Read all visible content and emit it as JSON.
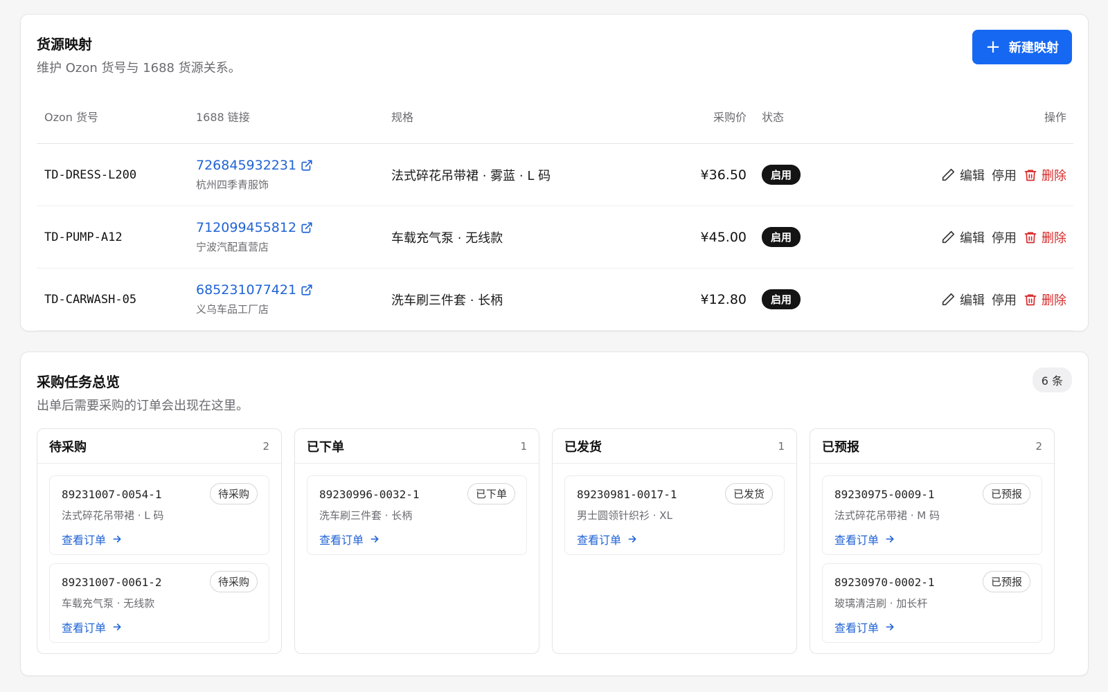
{
  "mapping": {
    "title": "货源映射",
    "subtitle": "维护 Ozon 货号与 1688 货源关系。",
    "new_button_label": "新建映射",
    "columns": {
      "ozon_sku": "Ozon 货号",
      "link": "1688 链接",
      "spec": "规格",
      "price": "采购价",
      "status": "状态",
      "actions": "操作"
    },
    "rows": [
      {
        "sku": "TD-DRESS-L200",
        "offer_id": "726845932231",
        "shop": "杭州四季青服饰",
        "spec": "法式碎花吊带裙 · 雾蓝 · L 码",
        "price": "¥36.50",
        "status": "启用"
      },
      {
        "sku": "TD-PUMP-A12",
        "offer_id": "712099455812",
        "shop": "宁波汽配直营店",
        "spec": "车载充气泵 · 无线款",
        "price": "¥45.00",
        "status": "启用"
      },
      {
        "sku": "TD-CARWASH-05",
        "offer_id": "685231077421",
        "shop": "义乌车品工厂店",
        "spec": "洗车刷三件套 · 长柄",
        "price": "¥12.80",
        "status": "启用"
      }
    ],
    "actions": {
      "edit": "编辑",
      "disable": "停用",
      "delete": "删除"
    }
  },
  "tasks": {
    "title": "采购任务总览",
    "subtitle": "出单后需要采购的订单会出现在这里。",
    "total": "6 条",
    "view_order_label": "查看订单",
    "columns": [
      {
        "title": "待采购",
        "count": "2",
        "items": [
          {
            "id": "89231007-0054-1",
            "status": "待采购",
            "desc": "法式碎花吊带裙 · L 码"
          },
          {
            "id": "89231007-0061-2",
            "status": "待采购",
            "desc": "车载充气泵 · 无线款"
          }
        ]
      },
      {
        "title": "已下单",
        "count": "1",
        "items": [
          {
            "id": "89230996-0032-1",
            "status": "已下单",
            "desc": "洗车刷三件套 · 长柄"
          }
        ]
      },
      {
        "title": "已发货",
        "count": "1",
        "items": [
          {
            "id": "89230981-0017-1",
            "status": "已发货",
            "desc": "男士圆领针织衫 · XL"
          }
        ]
      },
      {
        "title": "已预报",
        "count": "2",
        "items": [
          {
            "id": "89230975-0009-1",
            "status": "已预报",
            "desc": "法式碎花吊带裙 · M 码"
          },
          {
            "id": "89230970-0002-1",
            "status": "已预报",
            "desc": "玻璃清洁刷 · 加长杆"
          }
        ]
      }
    ]
  },
  "colors": {
    "primary": "#1668f2",
    "link": "#1f63d6",
    "danger": "#d72a2a",
    "badge": "#141414"
  }
}
